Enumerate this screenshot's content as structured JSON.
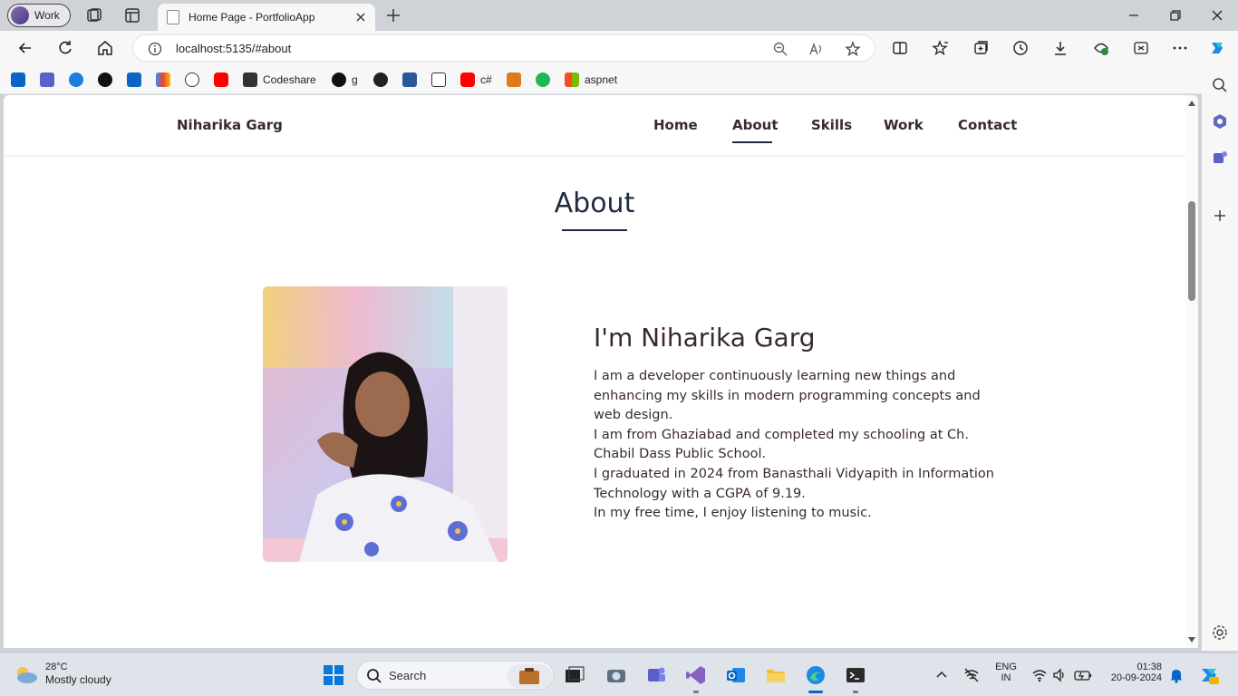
{
  "browser": {
    "profile_label": "Work",
    "tab_title": "Home Page - PortfolioApp",
    "url": "localhost:5135/#about",
    "favorites": [
      {
        "icon": "outlook-icon",
        "label": ""
      },
      {
        "icon": "teams-icon",
        "label": ""
      },
      {
        "icon": "onedrive-icon",
        "label": ""
      },
      {
        "icon": "github-icon",
        "label": ""
      },
      {
        "icon": "linkedin-icon",
        "label": ""
      },
      {
        "icon": "gmail-icon",
        "label": ""
      },
      {
        "icon": "chatgpt-icon",
        "label": ""
      },
      {
        "icon": "youtube-icon",
        "label": ""
      },
      {
        "icon": "codeshare-icon",
        "label": "Codeshare"
      },
      {
        "icon": "github-icon",
        "label": "g"
      },
      {
        "icon": "copilot-icon",
        "label": ""
      },
      {
        "icon": "word-icon",
        "label": ""
      },
      {
        "icon": "csharp-course-icon",
        "label": ""
      },
      {
        "icon": "youtube-icon",
        "label": "c#"
      },
      {
        "icon": "portrait-icon",
        "label": ""
      },
      {
        "icon": "spotify-icon",
        "label": ""
      },
      {
        "icon": "windows-icon",
        "label": "aspnet"
      }
    ]
  },
  "site": {
    "brand": "Niharika Garg",
    "nav": {
      "home": "Home",
      "about": "About",
      "skills": "Skills",
      "work": "Work",
      "contact": "Contact",
      "active": "About"
    },
    "about": {
      "section_title": "About",
      "heading": "I'm Niharika Garg",
      "paragraphs": [
        "I am a developer continuously learning new things and enhancing my skills in modern programming concepts and web design.",
        "I am from Ghaziabad and completed my schooling at Ch. Chabil Dass Public School.",
        "I graduated in 2024 from Banasthali Vidyapith in Information Technology with a CGPA of 9.19.",
        "In my free time, I enjoy listening to music."
      ]
    }
  },
  "taskbar": {
    "weather_temp": "28°C",
    "weather_condition": "Mostly cloudy",
    "search_placeholder": "Search",
    "language_line1": "ENG",
    "language_line2": "IN",
    "time": "01:38",
    "date": "20-09-2024"
  },
  "colors": {
    "accent": "#1f2a44",
    "text": "#3b2a2a",
    "edge_blue": "#0a64c8"
  }
}
